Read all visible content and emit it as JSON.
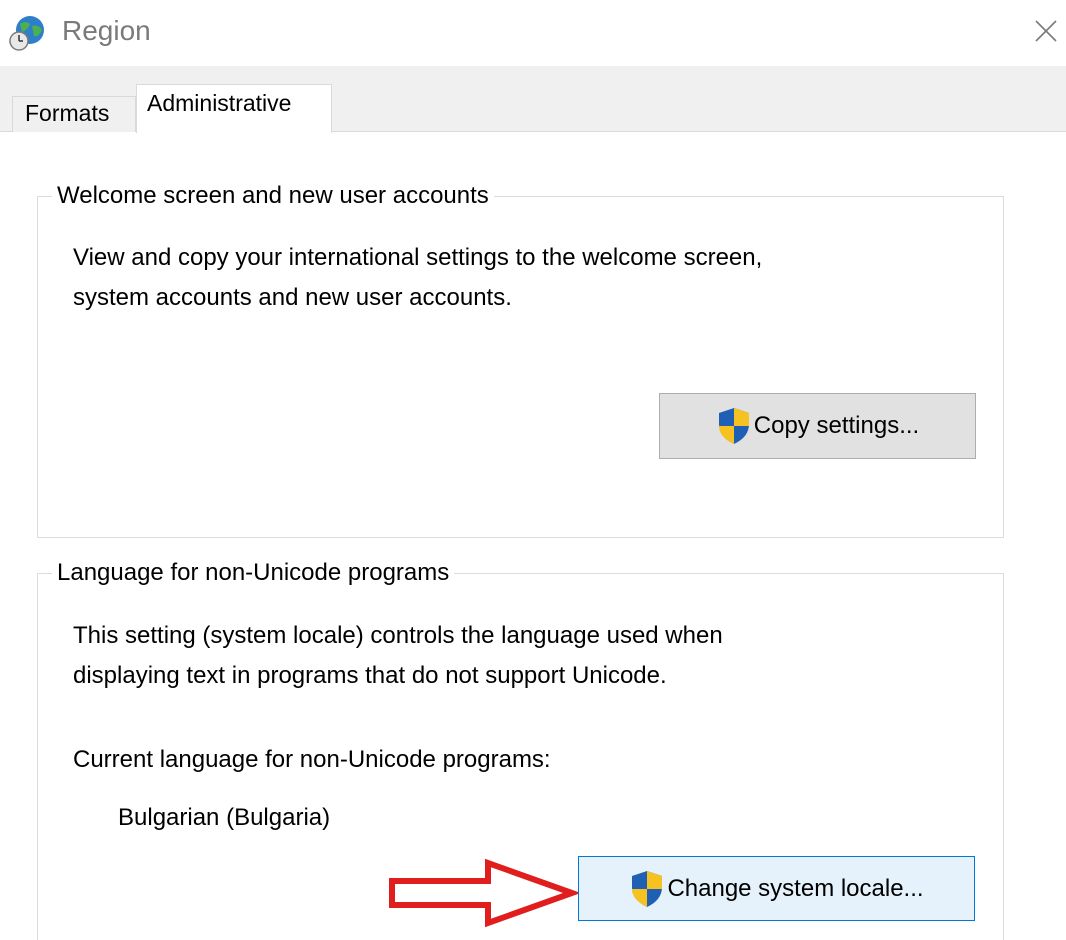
{
  "window": {
    "title": "Region",
    "app_icon": "globe-clock-icon",
    "close_icon": "close-icon"
  },
  "tabs": [
    {
      "label": "Formats",
      "selected": false
    },
    {
      "label": "Administrative",
      "selected": true
    }
  ],
  "welcome_group": {
    "caption": "Welcome screen and new user accounts",
    "description_line1": "View and copy your international settings to the welcome screen,",
    "description_line2": "system accounts and new user accounts.",
    "button_label": "Copy settings...",
    "button_icon": "uac-shield-icon"
  },
  "locale_group": {
    "caption": "Language for non-Unicode programs",
    "description_line1": "This setting (system locale) controls the language used when",
    "description_line2": "displaying text in programs that do not support Unicode.",
    "current_label": "Current language for non-Unicode programs:",
    "current_value": "Bulgarian (Bulgaria)",
    "button_label": "Change system locale...",
    "button_icon": "uac-shield-icon"
  },
  "annotation": {
    "type": "arrow-right",
    "color": "#e01e1e"
  },
  "colors": {
    "title_text": "#7a7a7a",
    "tab_strip_bg": "#f0f0f0",
    "button_bg": "#e1e1e1",
    "focused_button_bg": "#e5f1fb",
    "focused_button_border": "#0078d7",
    "shield_blue": "#1f5fb4",
    "shield_yellow": "#f5c221"
  }
}
